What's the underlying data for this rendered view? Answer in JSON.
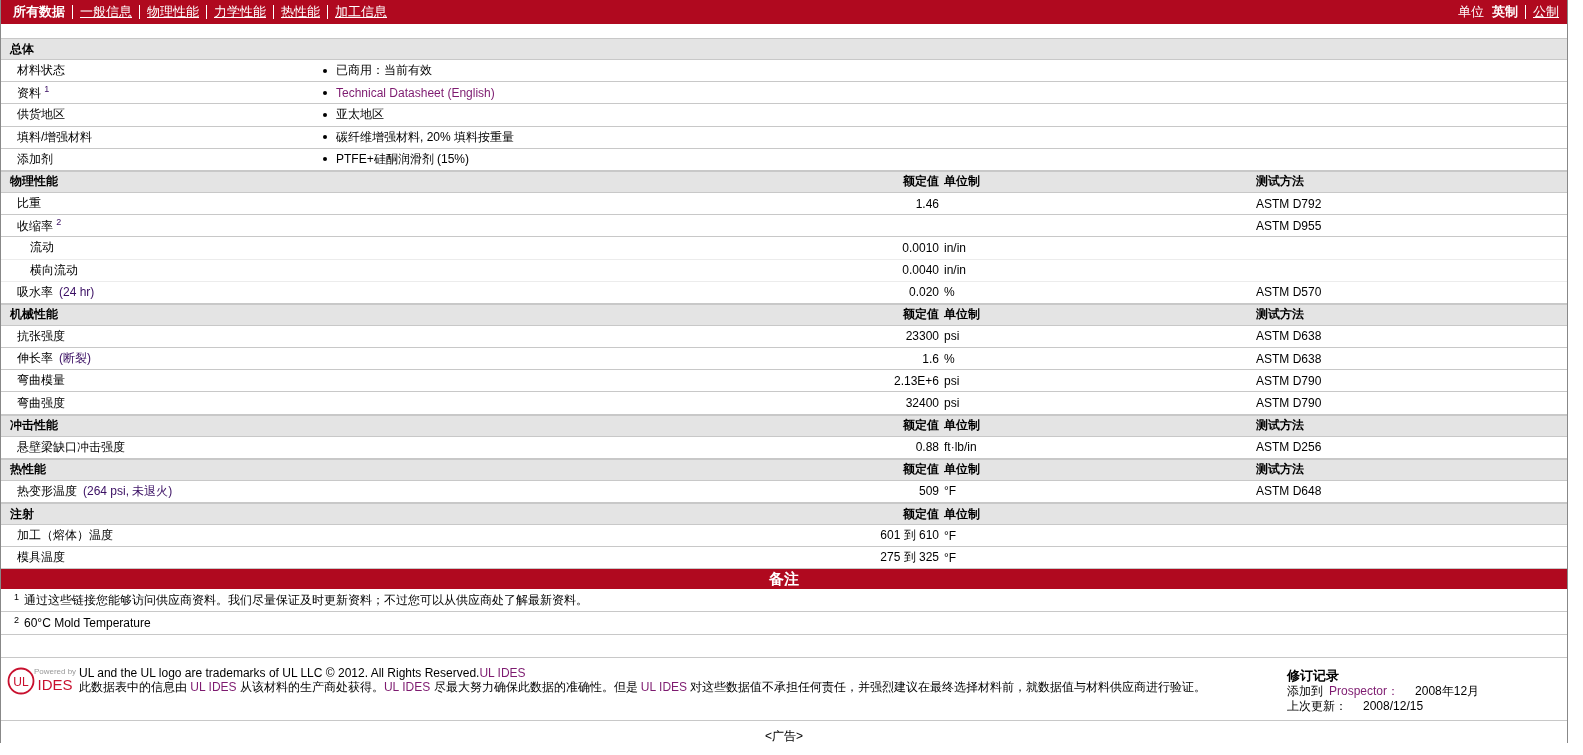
{
  "topbar": {
    "tabs": [
      {
        "label": "所有数据",
        "selected": true
      },
      {
        "label": "一般信息",
        "selected": false
      },
      {
        "label": "物理性能",
        "selected": false
      },
      {
        "label": "力学性能",
        "selected": false
      },
      {
        "label": "热性能",
        "selected": false
      },
      {
        "label": "加工信息",
        "selected": false
      }
    ],
    "units": {
      "label": "单位",
      "options": [
        {
          "label": "英制",
          "selected": true
        },
        {
          "label": "公制",
          "selected": false
        }
      ]
    }
  },
  "sections": [
    {
      "title": "总体",
      "kind": "general",
      "rows": [
        {
          "label": "材料状态",
          "value": "已商用：当前有效",
          "link": false
        },
        {
          "label": "资料 $^{1}$",
          "value": "Technical Datasheet (English)",
          "link": true
        },
        {
          "label": "供货地区",
          "value": "亚太地区",
          "link": false
        },
        {
          "label": "填料/增强材料",
          "value": "碳纤维增强材料, 20% 填料按重量",
          "link": false
        },
        {
          "label": "添加剂",
          "value": "PTFE+硅酮润滑剂  (15%)",
          "link": false
        }
      ]
    },
    {
      "title": "物理性能",
      "kind": "property",
      "columns": [
        "额定值",
        "单位制",
        "测试方法"
      ],
      "rows": [
        {
          "label": "比重",
          "value": "1.46",
          "method": "ASTM D792"
        },
        {
          "label": "收缩率 $^{2}$",
          "method": "ASTM D955",
          "children": [
            {
              "label": "流动",
              "value": "0.0010",
              "unit": "in/in"
            },
            {
              "label": "横向流动",
              "value": "0.0040",
              "unit": "in/in"
            }
          ]
        },
        {
          "label": "吸水率",
          "qualifier": "(24 hr)",
          "value": "0.020",
          "unit": "%",
          "method": "ASTM D570"
        }
      ]
    },
    {
      "title": "机械性能",
      "kind": "property",
      "columns": [
        "额定值",
        "单位制",
        "测试方法"
      ],
      "rows": [
        {
          "label": "抗张强度",
          "value": "23300",
          "unit": "psi",
          "method": "ASTM D638"
        },
        {
          "label": "伸长率",
          "qualifier": "(断裂)",
          "value": "1.6",
          "unit": "%",
          "method": "ASTM D638"
        },
        {
          "label": "弯曲模量",
          "value": "2.13E+6",
          "unit": "psi",
          "method": "ASTM D790"
        },
        {
          "label": "弯曲强度",
          "value": "32400",
          "unit": "psi",
          "method": "ASTM D790"
        }
      ]
    },
    {
      "title": "冲击性能",
      "kind": "property",
      "columns": [
        "额定值",
        "单位制",
        "测试方法"
      ],
      "rows": [
        {
          "label": "悬壁梁缺口冲击强度",
          "value": "0.88",
          "unit": "ft·lb/in",
          "method": "ASTM D256"
        }
      ]
    },
    {
      "title": "热性能",
      "kind": "property",
      "columns": [
        "额定值",
        "单位制",
        "测试方法"
      ],
      "rows": [
        {
          "label": "热变形温度",
          "qualifier": "(264 psi, 未退火)",
          "value": "509",
          "unit": "°F",
          "method": "ASTM D648"
        }
      ]
    },
    {
      "title": "注射",
      "kind": "property",
      "columns": [
        "额定值",
        "单位制"
      ],
      "rows": [
        {
          "label": "加工（熔体）温度",
          "value": "601 到  610",
          "unit": "°F"
        },
        {
          "label": "模具温度",
          "value": "275 到  325",
          "unit": "°F"
        }
      ]
    }
  ],
  "notes": {
    "title": "备注",
    "items": [
      {
        "mark": "1",
        "text": "通过这些链接您能够访问供应商资料。我们尽量保证及时更新资料；不过您可以从供应商处了解最新资料。"
      },
      {
        "mark": "2",
        "text": "60°C Mold Temperature"
      }
    ]
  },
  "footer": {
    "logo": {
      "mark": "UL",
      "caption": "Powered by",
      "name": "IDES"
    },
    "legal": [
      {
        "text": "UL and the UL logo are trademarks of UL LLC © 2012. All Rights Reserved.",
        "link": false
      },
      {
        "text": "UL IDES",
        "link": true
      }
    ],
    "disclaimer": [
      {
        "text": "此数据表中的信息由 ",
        "link": false
      },
      {
        "text": "UL IDES",
        "link": true
      },
      {
        "text": " 从该材料的生产商处获得。",
        "link": false
      },
      {
        "text": "UL IDES",
        "link": true
      },
      {
        "text": " 尽最大努力确保此数据的准确性。但是 ",
        "link": false
      },
      {
        "text": "UL IDES",
        "link": true
      },
      {
        "text": " 对这些数据值不承担任何责任，并强烈建议在最终选择材料前，就数据值与材料供应商进行验证。",
        "link": false
      }
    ],
    "revision": {
      "title": "修订记录",
      "entries": [
        {
          "label": "添加到",
          "link": "Prospector：",
          "value": "2008年12月"
        },
        {
          "label": "上次更新：",
          "value": "2008/12/15"
        }
      ]
    }
  },
  "ad": "<广告>"
}
